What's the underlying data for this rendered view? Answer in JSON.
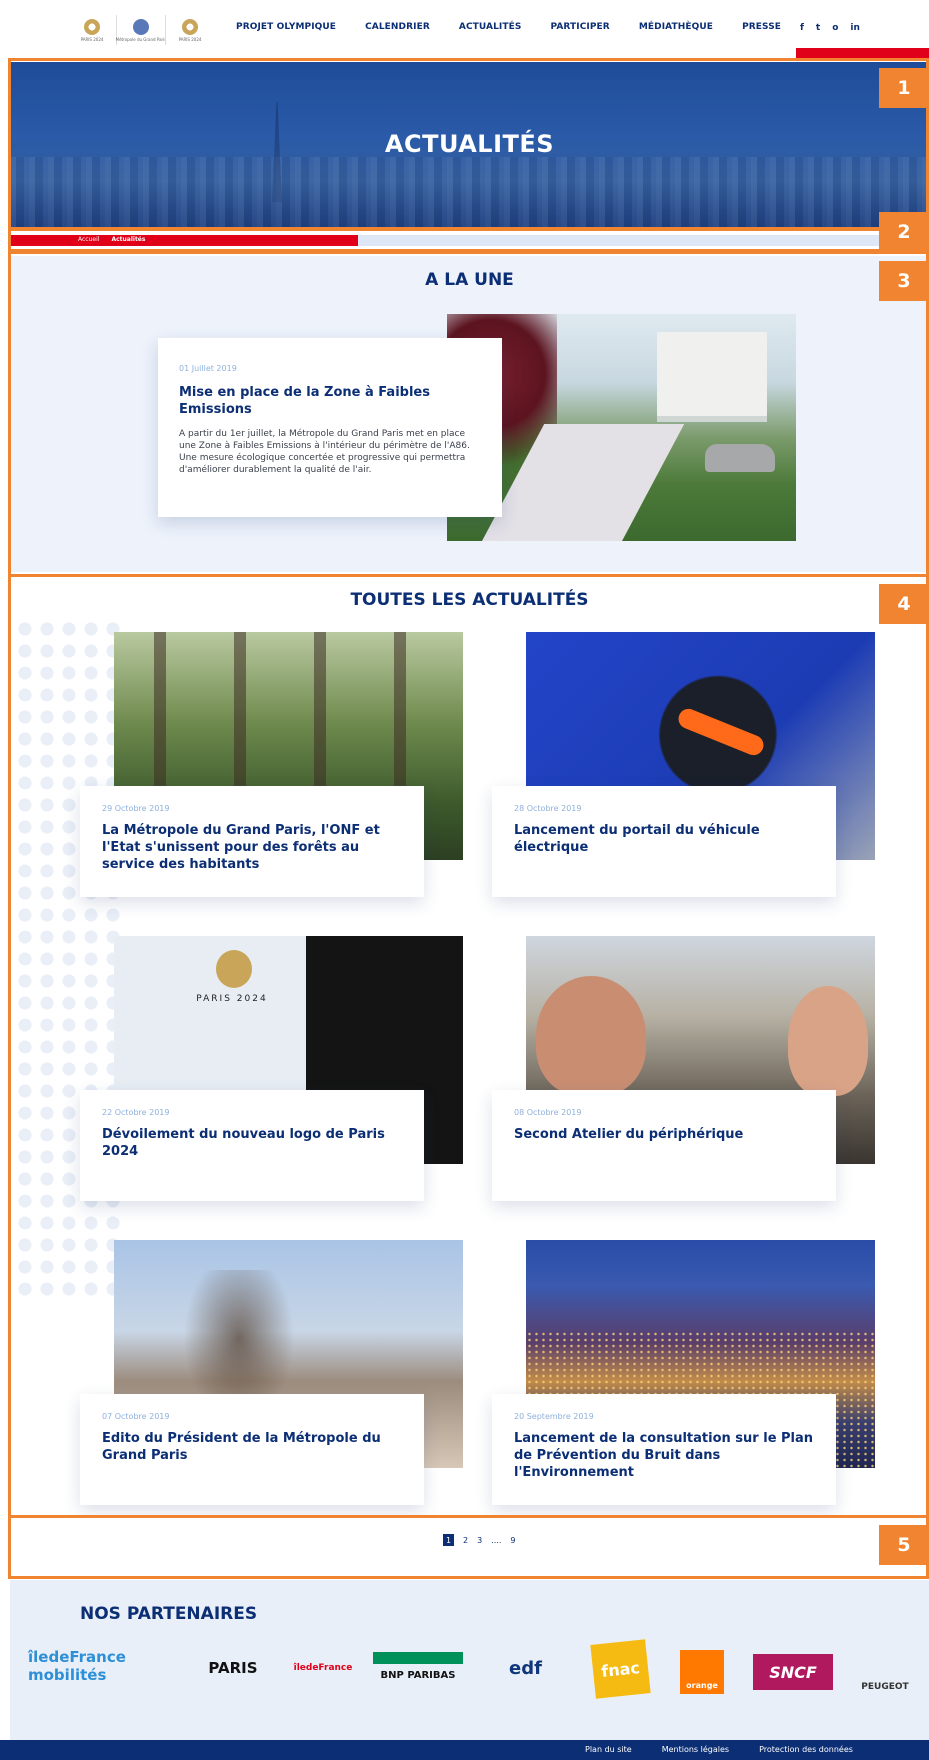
{
  "header": {
    "logos": [
      "PARIS 2024",
      "Métropole du Grand Paris",
      "PARIS 2024"
    ],
    "nav": [
      "PROJET OLYMPIQUE",
      "CALENDRIER",
      "ACTUALITÉS",
      "PARTICIPER",
      "MÉDIATHÈQUE",
      "PRESSE"
    ],
    "social": [
      "f",
      "t",
      "o",
      "in"
    ]
  },
  "annotations": [
    "1",
    "2",
    "3",
    "4",
    "5"
  ],
  "hero": {
    "title": "ACTUALITÉS"
  },
  "breadcrumb": {
    "home": "Accueil",
    "current": "Actualités"
  },
  "une": {
    "title": "A LA UNE",
    "date": "01 Juillet 2019",
    "headline": "Mise en place de la Zone à Faibles Emissions",
    "text": "A partir du 1er juillet, la Métropole du Grand Paris met en place une Zone à Faibles Emissions à l'intérieur du périmètre de l'A86. Une mesure écologique concertée et progressive qui permettra d'améliorer durablement la qualité de l'air."
  },
  "all": {
    "title": "TOUTES LES ACTUALITÉS",
    "articles": [
      {
        "date": "29 Octobre 2019",
        "title": "La Métropole du Grand Paris, l'ONF et l'Etat s'unissent pour des forêts au service des habitants"
      },
      {
        "date": "28 Octobre 2019",
        "title": "Lancement du portail du véhicule électrique"
      },
      {
        "date": "22 Octobre 2019",
        "title": "Dévoilement du nouveau logo de Paris 2024"
      },
      {
        "date": "08 Octobre 2019",
        "title": "Second Atelier du périphérique"
      },
      {
        "date": "07 Octobre 2019",
        "title": "Edito du Président de la Métropole du Grand Paris"
      },
      {
        "date": "20 Septembre 2019",
        "title": "Lancement de la consultation sur le Plan de Prévention du Bruit dans l'Environnement"
      }
    ],
    "image_texts": {
      "paris2024": "PARIS 2024"
    }
  },
  "pagination": [
    "1",
    "2",
    "3",
    "....",
    "9"
  ],
  "partners": {
    "title": "NOS PARTENAIRES",
    "logos": [
      "îledeFrance mobilités",
      "PARIS",
      "îledeFrance",
      "BNP PARIBAS",
      "edf",
      "fnac",
      "orange",
      "SNCF",
      "PEUGEOT"
    ]
  },
  "footer": {
    "links": [
      "Plan du site",
      "Mentions légales",
      "Protection des données"
    ]
  },
  "colors": {
    "navy": "#0b2e74",
    "red": "#e1001a",
    "annotation": "#f08431",
    "light_bg": "#edf2fb"
  }
}
